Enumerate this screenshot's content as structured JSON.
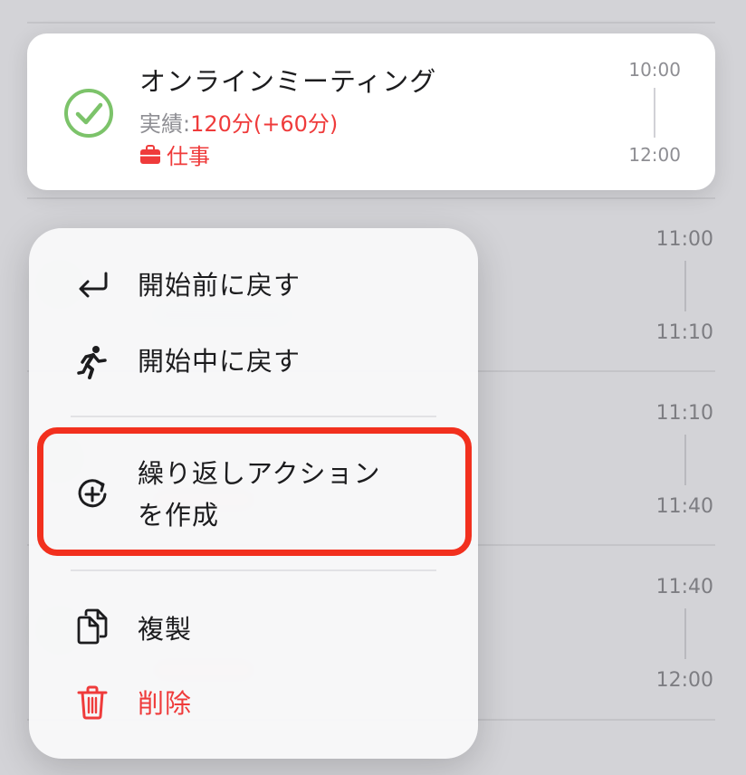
{
  "event": {
    "title": "オンラインミーティング",
    "actual_label": "実績:",
    "actual_value": "120分(+60分)",
    "category": "仕事",
    "time_start": "10:00",
    "time_end": "12:00"
  },
  "background_times": [
    {
      "start": "11:00",
      "end": "11:10"
    },
    {
      "start": "11:10",
      "end": "11:40"
    },
    {
      "start": "11:40",
      "end": "12:00"
    }
  ],
  "menu": {
    "revert_not_started": "開始前に戻す",
    "revert_in_progress": "開始中に戻す",
    "create_repeat_line1": "繰り返しアクション",
    "create_repeat_line2": "を作成",
    "duplicate": "複製",
    "delete": "削除"
  },
  "colors": {
    "accent_red": "#ef3b3b",
    "check_green": "#7cc36a",
    "highlight": "#f2301e"
  }
}
